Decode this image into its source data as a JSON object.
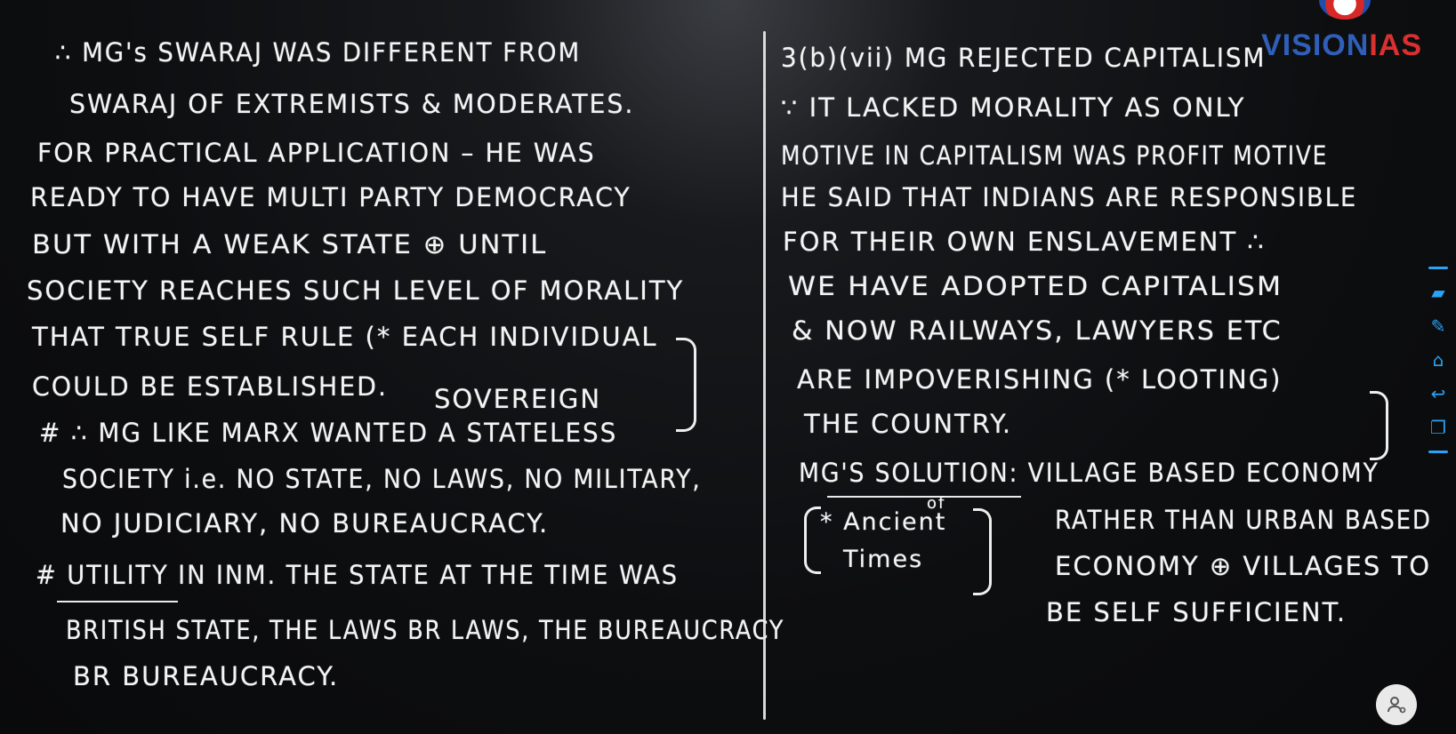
{
  "brand": {
    "vision": "VISION",
    "ias": "IAS",
    "accent_blue": "#2f5fb8",
    "accent_red": "#d93030"
  },
  "left_column": {
    "lines": [
      "∴ MG's SWARAJ WAS DIFFERENT FROM",
      "SWARAJ OF EXTREMISTS & MODERATES.",
      "FOR PRACTICAL APPLICATION – HE WAS",
      "READY TO HAVE MULTI PARTY DEMOCRACY",
      "BUT WITH A WEAK STATE ⊕ UNTIL",
      "SOCIETY REACHES SUCH LEVEL OF MORALITY",
      "THAT TRUE SELF RULE (* EACH INDIVIDUAL",
      "SOVEREIGN",
      "COULD BE ESTABLISHED.",
      "# ∴ MG LIKE MARX WANTED A STATELESS",
      "SOCIETY i.e. NO STATE, NO LAWS, NO MILITARY,",
      "NO JUDICIARY, NO BUREAUCRACY.",
      "# UTILITY IN INM. THE STATE AT THE TIME WAS",
      "BRITISH STATE, THE LAWS BR LAWS, THE BUREAUCRACY",
      "BR BUREAUCRACY."
    ]
  },
  "right_column": {
    "lines": [
      "3(b)(vii) MG REJECTED CAPITALISM",
      "∵ IT LACKED MORALITY AS ONLY",
      "MOTIVE IN CAPITALISM WAS PROFIT MOTIVE",
      "HE SAID THAT INDIANS ARE RESPONSIBLE",
      "FOR THEIR OWN ENSLAVEMENT ∴",
      "WE HAVE ADOPTED CAPITALISM",
      "& NOW RAILWAYS, LAWYERS ETC",
      "ARE IMPOVERISHING (* LOOTING)",
      "THE COUNTRY.",
      "MG'S SOLUTION: VILLAGE BASED ECONOMY",
      "RATHER THAN URBAN BASED",
      "ECONOMY ⊕ VILLAGES TO",
      "BE SELF SUFFICIENT."
    ],
    "aside_lines": [
      "* Ancient",
      "of",
      "Times"
    ]
  },
  "toolbar": {
    "icons": [
      "highlighter-icon",
      "pen-icon",
      "home-icon",
      "undo-icon",
      "copy-icon"
    ],
    "glyphs": [
      "▰",
      "✎",
      "⌂",
      "↩",
      "❐"
    ],
    "color": "#2aa3f5"
  }
}
